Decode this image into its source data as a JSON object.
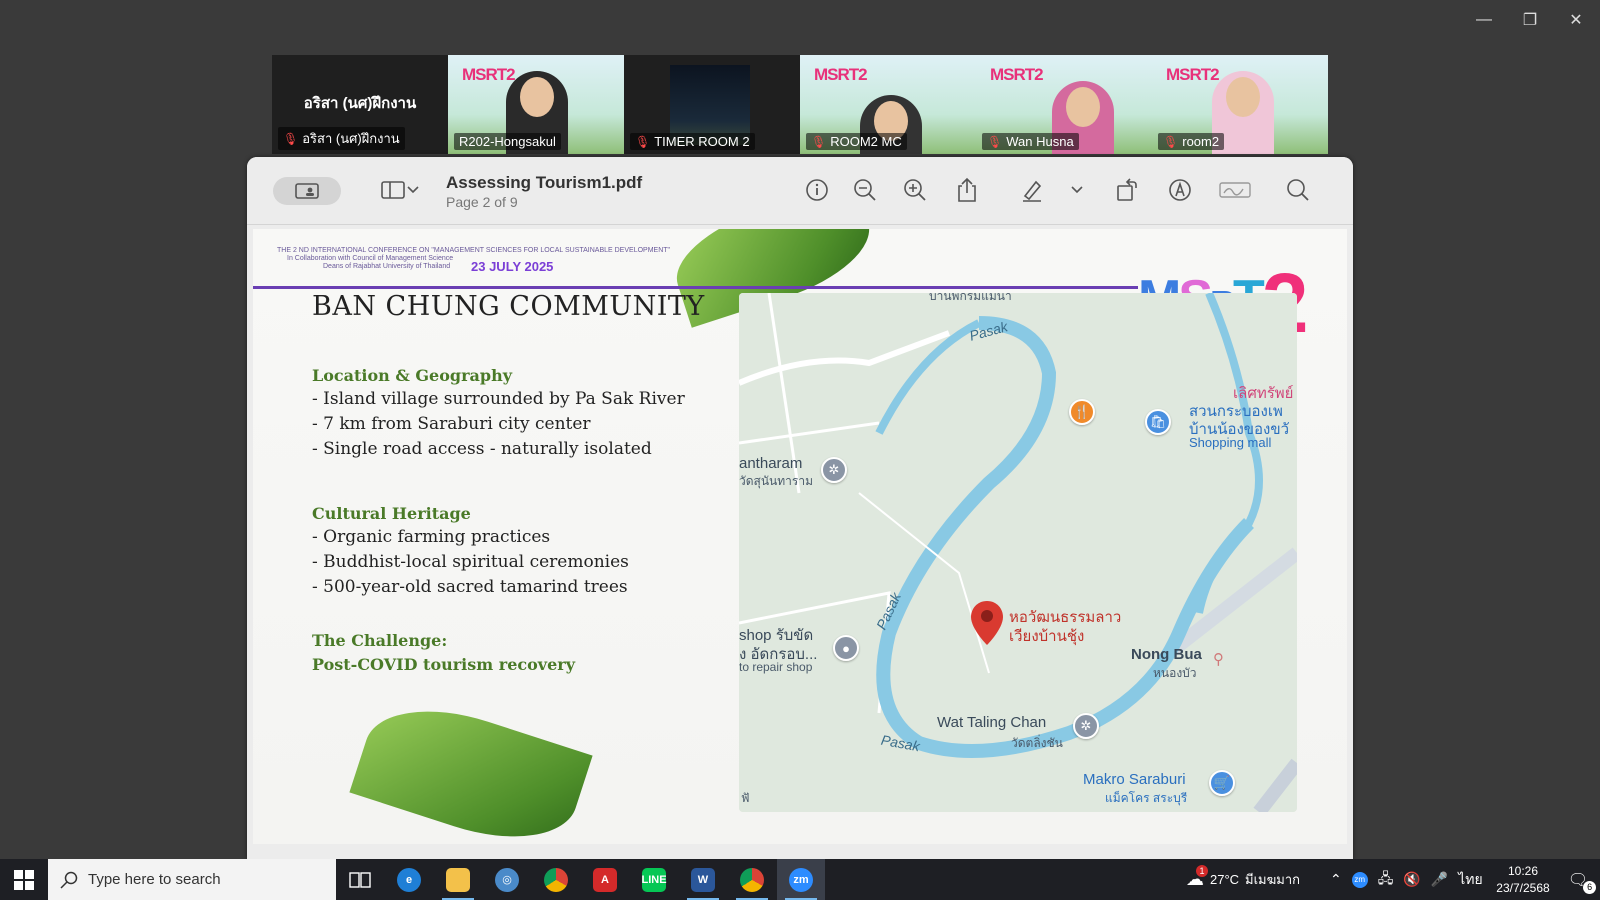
{
  "window_controls": {
    "minimize": "—",
    "restore": "❐",
    "close": "✕"
  },
  "participants": [
    {
      "name": "อริสา (นศ)ฝึกงาน",
      "big_name": "อริสา (นศ)ฝึกงาน",
      "muted": true,
      "active": false,
      "video": false
    },
    {
      "name": "R202-Hongsakul",
      "muted": false,
      "active": true,
      "video": true
    },
    {
      "name": "TIMER ROOM 2",
      "muted": true,
      "active": false,
      "video": true
    },
    {
      "name": "ROOM2 MC",
      "muted": true,
      "active": false,
      "video": true
    },
    {
      "name": "Wan Husna",
      "muted": true,
      "active": false,
      "video": true
    },
    {
      "name": "room2",
      "muted": true,
      "active": false,
      "video": true
    }
  ],
  "tile_logo": {
    "main": "MSRT",
    "num": "2"
  },
  "pdf": {
    "title": "Assessing Tourism1.pdf",
    "page": "Page 2 of 9",
    "toolbar_icons": [
      "sidebar-icon",
      "info-icon",
      "zoom-out-icon",
      "zoom-in-icon",
      "share-icon",
      "highlight-icon",
      "rotate-icon",
      "markup-icon",
      "signature-icon",
      "search-icon"
    ]
  },
  "slide": {
    "conference_line1": "THE 2 ND INTERNATIONAL CONFERENCE ON \"MANAGEMENT SCIENCES FOR LOCAL SUSTAINABLE DEVELOPMENT\"",
    "conference_line2": "In Collaboration with Council of Management Science",
    "conference_line3": "Deans of Rajabhat University of Thailand",
    "conference_date": "23 JULY 2025",
    "brand": {
      "m": "M",
      "s": "S",
      "r": "R",
      "t": "T",
      "two": "2"
    },
    "title": "BAN CHUNG COMMUNITY",
    "sections": [
      {
        "heading": "Location & Geography",
        "items": [
          "- Island village surrounded by Pa Sak River",
          "- 7 km from Saraburi city center",
          "- Single road access - naturally isolated"
        ]
      },
      {
        "heading": "Cultural Heritage",
        "items": [
          "- Organic farming practices",
          "- Buddhist-local spiritual ceremonies",
          "- 500-year-old sacred tamarind trees"
        ]
      },
      {
        "heading": "The Challenge:",
        "items": [
          "Post-COVID tourism recovery"
        ]
      }
    ],
    "map": {
      "top_label": "บ้านพักริมแม่น้ำ",
      "river_labels": [
        "Pasak",
        "Pasak",
        "Pasak"
      ],
      "antharam": "antharam",
      "antharam_th": "วัดสุนันทาราม",
      "shopping_pink": "เลิศทรัพย์",
      "shopping_line1": "สวนกระบองเพ",
      "shopping_line2": "บ้านน้องของขวั",
      "shopping_mall": "Shopping mall",
      "shop_line1": "shop รับขัด",
      "shop_line2": "ง อัดกรอบ...",
      "shop_line3": "to repair shop",
      "pin_line1": "หอวัฒนธรรมลาว",
      "pin_line2": "เวียงบ้านชุ้ง",
      "nong_bua": "Nong Bua",
      "nong_bua_th": "หนองบัว",
      "wat": "Wat Taling Chan",
      "wat_th": "วัดตลิ่งชัน",
      "makro": "Makro Saraburi",
      "makro_th": "แม็คโคร สระบุรี",
      "bottom_left": "ฟั"
    }
  },
  "taskbar": {
    "search_placeholder": "Type here to search",
    "apps": [
      "task-view",
      "edge",
      "file-explorer",
      "photos",
      "chrome",
      "acrobat",
      "line",
      "word",
      "chrome-profile",
      "zoom"
    ],
    "weather": "27°C",
    "weather_badge": "1",
    "weather_desc": "มีเมฆมาก",
    "lang": "ไทย",
    "time": "10:26",
    "date": "23/7/2568",
    "notif_count": "6"
  },
  "colors": {
    "accent_green": "#23d18b",
    "slide_green": "#4a7a28",
    "brand_purple": "#6a3fb3",
    "pin_red": "#d93a30"
  }
}
